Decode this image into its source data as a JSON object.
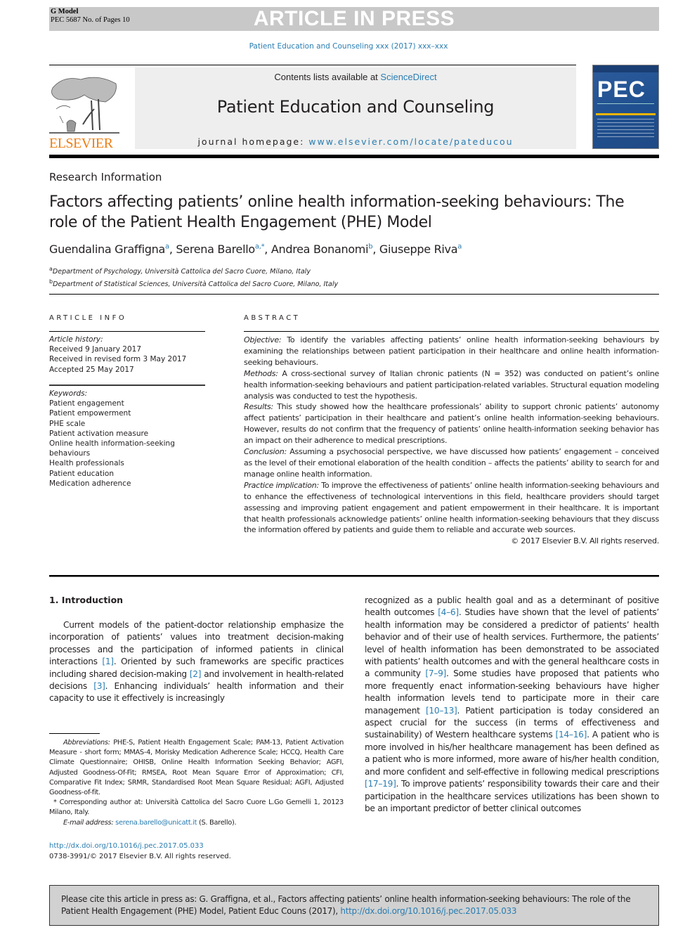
{
  "banner": {
    "model_label": "G Model",
    "manuscript_line": "PEC 5687 No. of Pages 10",
    "title": "ARTICLE IN PRESS"
  },
  "journal_ref": "Patient Education and Counseling xxx (2017) xxx–xxx",
  "masthead": {
    "publisher": "ELSEVIER",
    "contents_prefix": "Contents lists available at ",
    "contents_link": "ScienceDirect",
    "journal_name": "Patient Education and Counseling",
    "homepage_prefix": "journal homepage: ",
    "homepage_link": "www.elsevier.com/locate/pateducou",
    "cover_title": "PEC"
  },
  "article": {
    "type": "Research Information",
    "title": "Factors affecting patients’ online health information-seeking behaviours: The role of the Patient Health Engagement (PHE) Model",
    "authors": [
      {
        "name": "Guendalina Graffigna",
        "sup": "a"
      },
      {
        "name": "Serena Barello",
        "sup": "a,*"
      },
      {
        "name": "Andrea Bonanomi",
        "sup": "b"
      },
      {
        "name": "Giuseppe Riva",
        "sup": "a"
      }
    ],
    "affiliations": [
      {
        "sup": "a",
        "text": "Department of Psychology, Università Cattolica del Sacro Cuore, Milano, Italy"
      },
      {
        "sup": "b",
        "text": "Department of Statistical Sciences, Università Cattolica del Sacro Cuore, Milano, Italy"
      }
    ]
  },
  "article_info": {
    "heading": "ARTICLE INFO",
    "history_label": "Article history:",
    "history": [
      "Received 9 January 2017",
      "Received in revised form 3 May 2017",
      "Accepted 25 May 2017"
    ],
    "keywords_label": "Keywords:",
    "keywords": [
      "Patient engagement",
      "Patient empowerment",
      "PHE scale",
      "Patient activation measure",
      "Online health information-seeking behaviours",
      "Health professionals",
      "Patient education",
      "Medication adherence"
    ]
  },
  "abstract": {
    "heading": "ABSTRACT",
    "sections": [
      {
        "label": "Objective:",
        "text": " To identify the variables affecting patients’ online health information-seeking behaviours by examining the relationships between patient participation in their healthcare and online health information-seeking behaviours."
      },
      {
        "label": "Methods:",
        "text": " A cross-sectional survey of Italian chronic patients (N = 352) was conducted on patient’s online health information-seeking behaviours and patient participation-related variables. Structural equation modeling analysis was conducted to test the hypothesis."
      },
      {
        "label": "Results:",
        "text": " This study showed how the healthcare professionals’ ability to support chronic patients’ autonomy affect patients’ participation in their healthcare and patient’s online health information-seeking behaviours. However, results do not confirm that the frequency of patients’ online health-information seeking behavior has an impact on their adherence to medical prescriptions."
      },
      {
        "label": "Conclusion:",
        "text": " Assuming a psychosocial perspective, we have discussed how patients’ engagement – conceived as the level of their emotional elaboration of the health condition – affects the patients’ ability to search for and manage online health information."
      },
      {
        "label": "Practice implication:",
        "text": " To improve the effectiveness of patients’ online health information-seeking behaviours and to enhance the effectiveness of technological interventions in this field, healthcare providers should target assessing and improving patient engagement and patient empowerment in their healthcare. It is important that health professionals acknowledge patients’ online health information-seeking behaviours that they discuss the information offered by patients and guide them to reliable and accurate web sources."
      }
    ],
    "copyright": "© 2017 Elsevier B.V. All rights reserved."
  },
  "introduction": {
    "heading": "1. Introduction",
    "left_segments": [
      {
        "t": "Current models of the patient-doctor relationship emphasize the incorporation of patients’ values into treatment decision-making processes and the participation of informed patients in clinical interactions "
      },
      {
        "ref": "[1]"
      },
      {
        "t": ". Oriented by such frameworks are specific practices including shared decision-making "
      },
      {
        "ref": "[2]"
      },
      {
        "t": " and involvement in health-related decisions "
      },
      {
        "ref": "[3]"
      },
      {
        "t": ". Enhancing individuals’ health information and their capacity to use it effectively is increasingly"
      }
    ],
    "right_segments": [
      {
        "t": "recognized as a public health goal and as a determinant of positive health outcomes "
      },
      {
        "ref": "[4–6]"
      },
      {
        "t": ". Studies have shown that the level of patients’ health information may be considered a predictor of patients’ health behavior and of their use of health services. Furthermore, the patients’ level of health information has been demonstrated to be associated with patients’ health outcomes and with the general healthcare costs in a community "
      },
      {
        "ref": "[7–9]"
      },
      {
        "t": ". Some studies have proposed that patients who more frequently enact information-seeking behaviours have higher health information levels tend to participate more in their care management "
      },
      {
        "ref": "[10–13]"
      },
      {
        "t": ". Patient participation is today considered an aspect crucial for the success (in terms of effectiveness and sustainability) of Western healthcare systems "
      },
      {
        "ref": "[14–16]"
      },
      {
        "t": ". A patient who is more involved in his/her healthcare management has been defined as a patient who is more informed, more aware of his/her health condition, and more confident and self-effective in following medical prescriptions "
      },
      {
        "ref": "[17–19]"
      },
      {
        "t": ". To improve patients’ responsibility towards their care and their participation in the healthcare services utilizations has been shown to be an important predictor of better clinical outcomes"
      }
    ]
  },
  "footnotes": {
    "abbreviations_label": "Abbreviations:",
    "abbreviations_text": " PHE-S, Patient Health Engagement Scale; PAM-13, Patient Activation Measure - short form; MMAS-4, Morisky Medication Adherence Scale; HCCQ, Health Care Climate Questionnaire; OHISB, Online Health Information Seeking Behavior; AGFI, Adjusted Goodness-Of-Fit; RMSEA, Root Mean Square Error of Approximation; CFI, Comparative Fit Index; SRMR, Standardised Root Mean Square Residual; AGFI, Adjusted Goodness-of-fit.",
    "corresponding": " * Corresponding author at: Università Cattolica del Sacro Cuore L.Go Gemelli 1, 20123 Milano, Italy.",
    "email_label": "E-mail address:",
    "email": "serena.barello@unicatt.it",
    "email_suffix": " (S. Barello)."
  },
  "doi": {
    "url": "http://dx.doi.org/10.1016/j.pec.2017.05.033",
    "issn_line": "0738-3991/© 2017 Elsevier B.V. All rights reserved."
  },
  "citation": {
    "text": "Please cite this article in press as: G. Graffigna, et al., Factors affecting patients’ online health information-seeking behaviours: The role of the Patient Health Engagement (PHE) Model, Patient Educ Couns (2017), ",
    "link": "http://dx.doi.org/10.1016/j.pec.2017.05.033"
  }
}
